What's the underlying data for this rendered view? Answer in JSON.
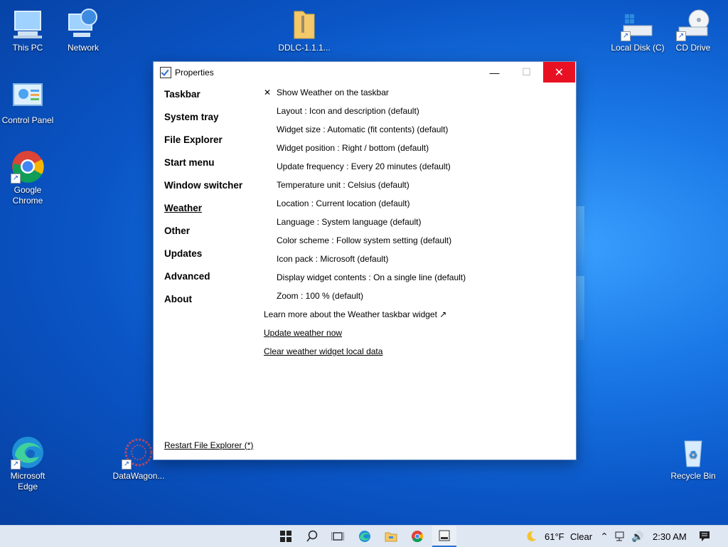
{
  "desktop": {
    "icons": [
      {
        "label": "This PC"
      },
      {
        "label": "Network"
      },
      {
        "label": "DDLC-1.1.1..."
      },
      {
        "label": "Local Disk (C)"
      },
      {
        "label": "CD Drive"
      },
      {
        "label": "Control Panel"
      },
      {
        "label": "Google Chrome"
      },
      {
        "label": "Microsoft Edge"
      },
      {
        "label": "DataWagon..."
      },
      {
        "label": "Recycle Bin"
      }
    ]
  },
  "window": {
    "title": "Properties",
    "controls": {
      "minimize": "—",
      "maximize": "☐",
      "close": "✕"
    },
    "nav": [
      {
        "label": "Taskbar"
      },
      {
        "label": "System tray"
      },
      {
        "label": "File Explorer"
      },
      {
        "label": "Start menu"
      },
      {
        "label": "Window switcher"
      },
      {
        "label": "Weather",
        "active": true
      },
      {
        "label": "Other"
      },
      {
        "label": "Updates"
      },
      {
        "label": "Advanced"
      },
      {
        "label": "About"
      }
    ],
    "settings": {
      "show_weather": {
        "check": "✕",
        "label": "Show Weather on the taskbar"
      },
      "options": [
        "Layout : Icon and description (default)",
        "Widget size : Automatic (fit contents) (default)",
        "Widget position : Right / bottom (default)",
        "Update frequency : Every 20 minutes (default)",
        "Temperature unit : Celsius (default)",
        "Location : Current location (default)",
        "Language : System language (default)",
        "Color scheme : Follow system setting (default)",
        "Icon pack : Microsoft (default)",
        "Display widget contents : On a single line (default)",
        "Zoom : 100 % (default)"
      ],
      "learn_more": "Learn more about the Weather taskbar widget ↗",
      "update_now": "Update weather now",
      "clear_data": "Clear weather widget local data"
    },
    "restart_link": "Restart File Explorer (*)"
  },
  "taskbar": {
    "weather": {
      "temp": "61°F",
      "condition": "Clear"
    },
    "time": "2:30 AM"
  },
  "colors": {
    "accent": "#2b6fd6",
    "close_red": "#e81123"
  }
}
